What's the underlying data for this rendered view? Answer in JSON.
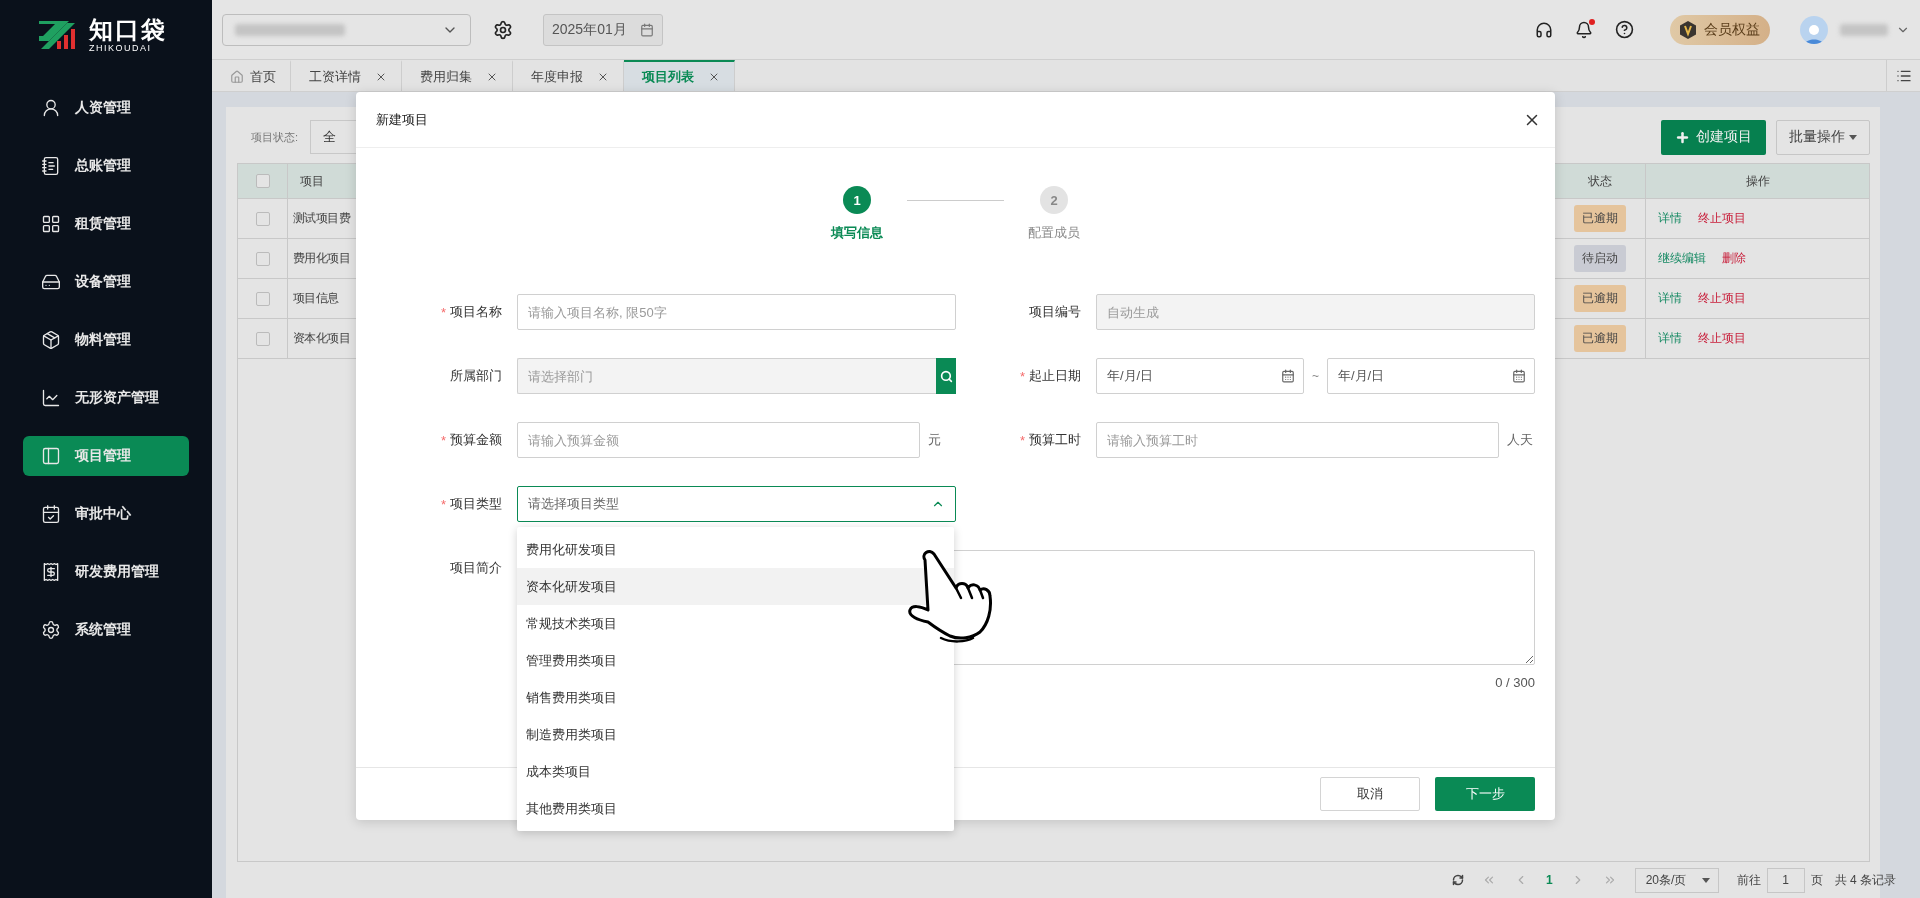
{
  "sidebar": {
    "logo": {
      "name": "知口袋",
      "subtitle": "ZHIKOUDAI"
    },
    "items": [
      {
        "label": "人资管理",
        "selected": false
      },
      {
        "label": "总账管理",
        "selected": false
      },
      {
        "label": "租赁管理",
        "selected": false
      },
      {
        "label": "设备管理",
        "selected": false
      },
      {
        "label": "物料管理",
        "selected": false
      },
      {
        "label": "无形资产管理",
        "selected": false
      },
      {
        "label": "项目管理",
        "selected": true
      },
      {
        "label": "审批中心",
        "selected": false
      },
      {
        "label": "研发费用管理",
        "selected": false
      },
      {
        "label": "系统管理",
        "selected": false
      }
    ]
  },
  "header": {
    "date": "2025年01月",
    "vip": "会员权益",
    "notification_dot": true
  },
  "tabs": [
    {
      "label": "首页",
      "kind": "home",
      "selected": false
    },
    {
      "label": "工资详情",
      "kind": "page",
      "selected": false
    },
    {
      "label": "费用归集",
      "kind": "page",
      "selected": false
    },
    {
      "label": "年度申报",
      "kind": "page",
      "selected": false
    },
    {
      "label": "项目列表",
      "kind": "page",
      "selected": true
    }
  ],
  "filter": {
    "label": "项目状态:",
    "value": "全"
  },
  "toolbar": {
    "create": "创建项目",
    "batch": "批量操作"
  },
  "table": {
    "header_checked": false,
    "columns": [
      "项目",
      "状态",
      "操作"
    ],
    "rows": [
      {
        "checked": false,
        "name": "测试项目费",
        "status": {
          "label": "已逾期",
          "color": "#e5c49c"
        },
        "actions": [
          {
            "label": "详情",
            "kind": "primary"
          },
          {
            "label": "终止项目",
            "kind": "danger"
          }
        ]
      },
      {
        "checked": false,
        "name": "费用化项目",
        "status": {
          "label": "待启动",
          "color": "#c9cbd3"
        },
        "actions": [
          {
            "label": "继续编辑",
            "kind": "primary"
          },
          {
            "label": "删除",
            "kind": "danger"
          }
        ]
      },
      {
        "checked": false,
        "name": "项目信息",
        "status": {
          "label": "已逾期",
          "color": "#e5c49c"
        },
        "actions": [
          {
            "label": "详情",
            "kind": "primary"
          },
          {
            "label": "终止项目",
            "kind": "danger"
          }
        ]
      },
      {
        "checked": false,
        "name": "资本化项目",
        "status": {
          "label": "已逾期",
          "color": "#e5c49c"
        },
        "actions": [
          {
            "label": "详情",
            "kind": "primary"
          },
          {
            "label": "终止项目",
            "kind": "danger"
          }
        ]
      }
    ]
  },
  "pagination": {
    "current_page": "1",
    "page_size": "20条/页",
    "goto_label": "前往",
    "goto_value": "1",
    "page_unit": "页",
    "total": "共 4 条记录"
  },
  "dialog": {
    "title": "新建项目",
    "required_mark": "*",
    "steps": [
      {
        "number": "1",
        "label": "填写信息",
        "active": true
      },
      {
        "number": "2",
        "label": "配置成员",
        "active": false
      }
    ],
    "fields": [
      {
        "kind": "text",
        "label": "项目名称",
        "required": true,
        "placeholder": "请输入项目名称, 限50字"
      },
      {
        "kind": "readonly",
        "label": "项目编号",
        "required": false,
        "placeholder": "自动生成"
      },
      {
        "kind": "search",
        "label": "所属部门",
        "required": false,
        "placeholder": "请选择部门"
      },
      {
        "kind": "daterange",
        "label": "起止日期",
        "required": true,
        "placeholders": [
          "年/月/日",
          "年/月/日"
        ],
        "separator": "~"
      },
      {
        "kind": "text",
        "label": "预算金额",
        "required": true,
        "placeholder": "请输入预算金额",
        "unit": "元"
      },
      {
        "kind": "text",
        "label": "预算工时",
        "required": true,
        "placeholder": "请输入预算工时",
        "unit": "人天"
      },
      {
        "kind": "select",
        "label": "项目类型",
        "required": true,
        "placeholder": "请选择项目类型",
        "expanded": true,
        "options": [
          {
            "label": "费用化研发项目",
            "hovered": false
          },
          {
            "label": "资本化研发项目",
            "hovered": true
          },
          {
            "label": "常规技术类项目",
            "hovered": false
          },
          {
            "label": "管理费用类项目",
            "hovered": false
          },
          {
            "label": "销售费用类项目",
            "hovered": false
          },
          {
            "label": "制造费用类项目",
            "hovered": false
          },
          {
            "label": "成本类项目",
            "hovered": false
          },
          {
            "label": "其他费用类项目",
            "hovered": false
          }
        ]
      },
      {
        "kind": "textarea",
        "label": "项目简介",
        "required": false,
        "counter": "0 / 300"
      }
    ],
    "buttons": {
      "cancel": "取消",
      "next": "下一步"
    }
  }
}
